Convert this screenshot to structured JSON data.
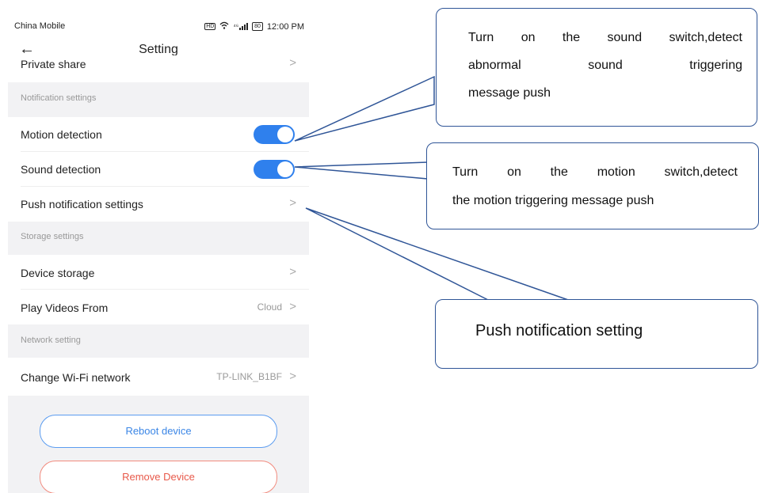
{
  "status_bar": {
    "carrier": "China Mobile",
    "signal_label": "⁴⁶",
    "battery": "80",
    "time": "12:00 PM"
  },
  "header": {
    "back_glyph": "←",
    "title": "Setting"
  },
  "rows": {
    "private_share": "Private share",
    "motion_detection": "Motion detection",
    "sound_detection": "Sound detection",
    "push_notification_settings": "Push notification settings",
    "device_storage": "Device storage",
    "play_videos_from": "Play Videos From",
    "play_videos_value": "Cloud",
    "change_wifi": "Change Wi-Fi network",
    "wifi_value": "TP-LINK_B1BF",
    "chevron": ">"
  },
  "sections": {
    "notification": "Notification settings",
    "storage": "Storage settings",
    "network": "Network setting"
  },
  "toggles": {
    "motion_detection_on": true,
    "sound_detection_on": true
  },
  "buttons": {
    "reboot": "Reboot device",
    "remove": "Remove Device"
  },
  "callouts": {
    "sound": [
      "Turn on the sound switch,detect",
      "abnormal sound triggering",
      "message push"
    ],
    "motion": [
      "Turn on the motion switch,detect",
      "the motion triggering message push"
    ],
    "push": "Push notification setting"
  },
  "colors": {
    "accent": "#2f80ed",
    "danger": "#e8594a",
    "callout_border": "#2f5597",
    "section_bg": "#f2f2f4"
  }
}
